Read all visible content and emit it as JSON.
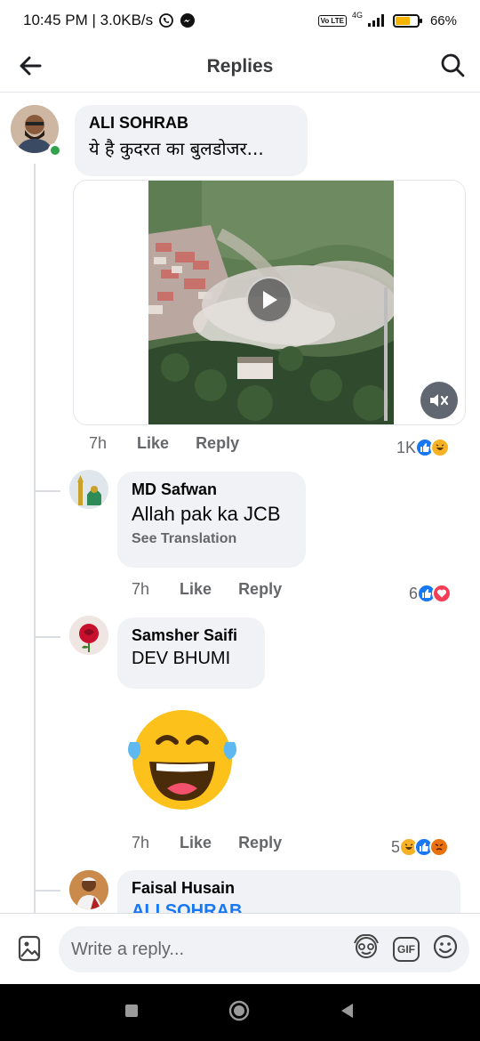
{
  "status_bar": {
    "time_speed": "10:45 PM | 3.0KB/s",
    "network_label": "4G",
    "volte_label": "Vo LTE",
    "battery_percent": "66%",
    "battery_level": 0.66
  },
  "header": {
    "title": "Replies",
    "back_icon": "back-arrow-icon",
    "search_icon": "search-icon"
  },
  "comments": [
    {
      "author": "ALI SOHRAB",
      "text": "ये है कुदरत का बुलडोजर...",
      "time": "7h",
      "like_label": "Like",
      "reply_label": "Reply",
      "reaction_count": "1K",
      "reactions": [
        "like",
        "haha"
      ],
      "online": true
    },
    {
      "author": "MD Safwan",
      "text": "Allah pak ka JCB",
      "see_translation": "See Translation",
      "time": "7h",
      "like_label": "Like",
      "reply_label": "Reply",
      "reaction_count": "6",
      "reactions": [
        "like",
        "love"
      ]
    },
    {
      "author": "Samsher Saifi",
      "text": "DEV BHUMI",
      "time": "7h",
      "like_label": "Like",
      "reply_label": "Reply",
      "reaction_count": "5",
      "reactions": [
        "haha",
        "like",
        "angry"
      ],
      "sticker": "laughing-tears-emoji"
    },
    {
      "author": "Faisal Husain",
      "text": "ALI SOHRAB"
    }
  ],
  "composer": {
    "placeholder": "Write a reply...",
    "gif_label": "GIF"
  },
  "colors": {
    "like_blue": "#1877f2",
    "love_red": "#f33e58",
    "haha_yellow": "#f7b125",
    "angry_orange": "#e9710f",
    "bubble_bg": "#f0f2f5",
    "online_green": "#31a24c"
  }
}
